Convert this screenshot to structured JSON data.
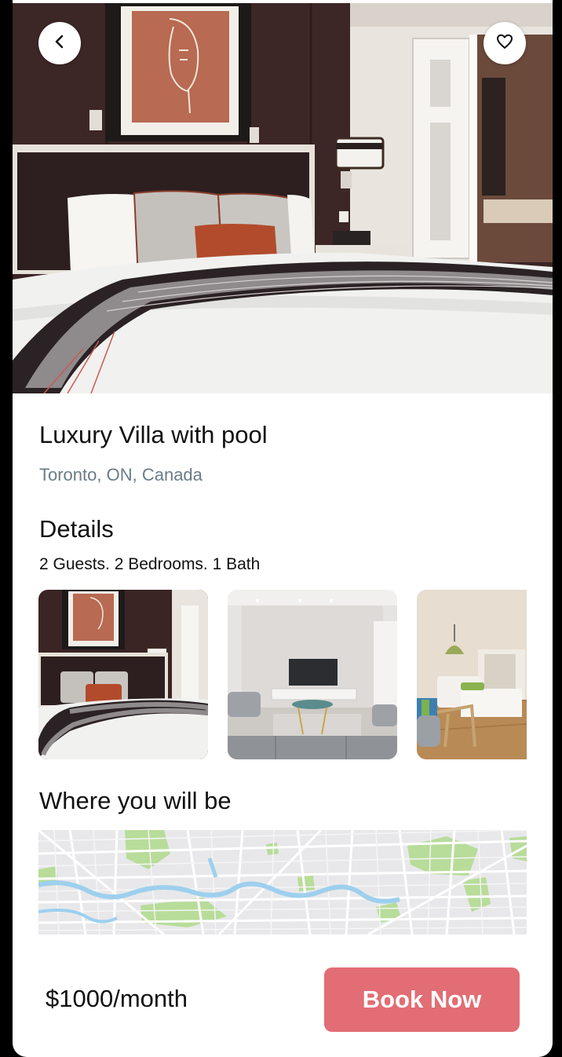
{
  "listing": {
    "title": "Luxury Villa with pool",
    "location": "Toronto, ON, Canada"
  },
  "details": {
    "heading": "Details",
    "summary": "2 Guests. 2 Bedrooms. 1 Bath"
  },
  "gallery": {
    "items": [
      {
        "name": "bedroom-photo"
      },
      {
        "name": "living-room-photo"
      },
      {
        "name": "studio-room-photo"
      }
    ]
  },
  "map_section": {
    "heading": "Where you will be"
  },
  "footer": {
    "price": "$1000/month",
    "book_label": "Book Now"
  },
  "colors": {
    "accent": "#e26d74",
    "location_text": "#6a7c87"
  },
  "icons": {
    "back": "chevron-left-icon",
    "favorite": "heart-outline-icon"
  }
}
